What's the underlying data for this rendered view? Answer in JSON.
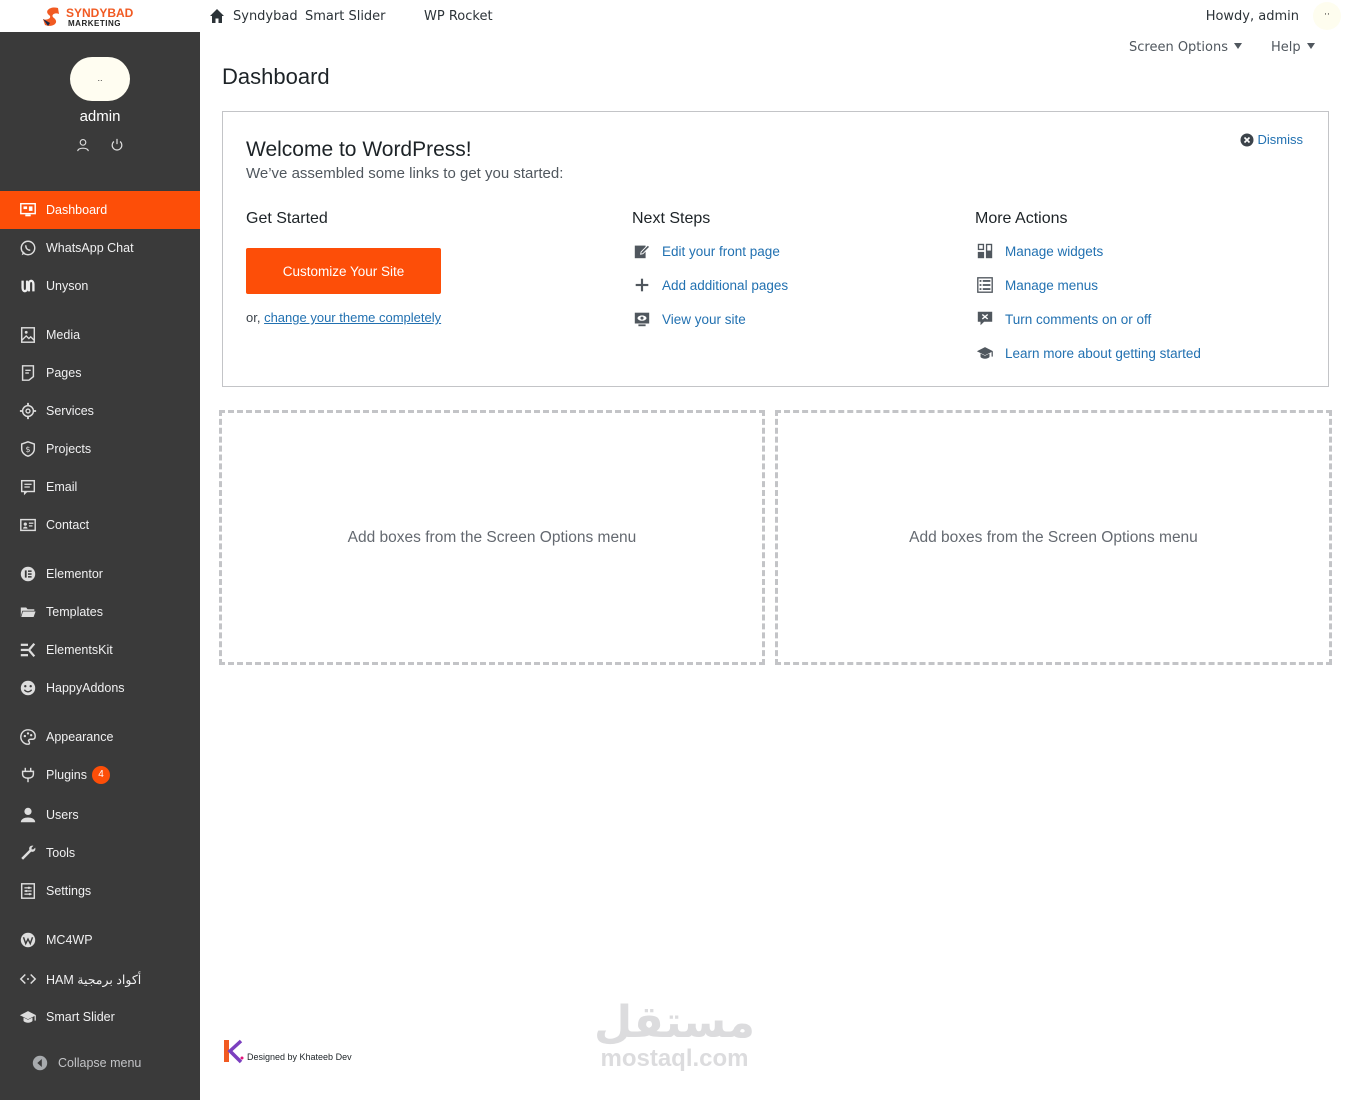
{
  "adminbar": {
    "logo_line1": "SYNDYBAD",
    "logo_line2": "MARKETING",
    "site_name": "Syndybad",
    "item_smart_slider": "Smart Slider",
    "item_wp_rocket": "WP Rocket",
    "howdy": "Howdy, admin",
    "avatar_text": "··"
  },
  "profile": {
    "pic_text": "..",
    "name": "admin"
  },
  "sidebar": {
    "items": [
      {
        "label": "Dashboard",
        "icon": "dashboard-icon"
      },
      {
        "label": "WhatsApp Chat",
        "icon": "whatsapp-icon"
      },
      {
        "label": "Unyson",
        "icon": "unyson-icon"
      },
      {
        "label": "Media",
        "icon": "media-icon"
      },
      {
        "label": "Pages",
        "icon": "pages-icon"
      },
      {
        "label": "Services",
        "icon": "services-icon"
      },
      {
        "label": "Projects",
        "icon": "projects-icon"
      },
      {
        "label": "Email",
        "icon": "email-icon"
      },
      {
        "label": "Contact",
        "icon": "contact-icon"
      },
      {
        "label": "Elementor",
        "icon": "elementor-icon"
      },
      {
        "label": "Templates",
        "icon": "templates-icon"
      },
      {
        "label": "ElementsKit",
        "icon": "elementskit-icon"
      },
      {
        "label": "HappyAddons",
        "icon": "happyaddons-icon"
      },
      {
        "label": "Appearance",
        "icon": "appearance-icon"
      },
      {
        "label": "Plugins",
        "icon": "plugins-icon",
        "badge": "4"
      },
      {
        "label": "Users",
        "icon": "users-icon"
      },
      {
        "label": "Tools",
        "icon": "tools-icon"
      },
      {
        "label": "Settings",
        "icon": "settings-icon"
      },
      {
        "label": "MC4WP",
        "icon": "mc4wp-icon"
      },
      {
        "label": "HAM أكواد برمجية",
        "icon": "code-icon"
      },
      {
        "label": "Smart Slider",
        "icon": "smart-slider-icon"
      }
    ],
    "collapse_label": "Collapse menu"
  },
  "screen_meta": {
    "screen_options": "Screen Options",
    "help": "Help"
  },
  "page": {
    "title": "Dashboard"
  },
  "welcome": {
    "heading": "Welcome to WordPress!",
    "about": "We’ve assembled some links to get you started:",
    "dismiss": "Dismiss",
    "get_started": {
      "heading": "Get Started",
      "button": "Customize Your Site",
      "or_text": "or, ",
      "link": "change your theme completely"
    },
    "next_steps": {
      "heading": "Next Steps",
      "links": [
        "Edit your front page",
        "Add additional pages",
        "View your site"
      ]
    },
    "more_actions": {
      "heading": "More Actions",
      "links": [
        "Manage widgets",
        "Manage menus",
        "Turn comments on or off",
        "Learn more about getting started"
      ]
    }
  },
  "dropzones": [
    "Add boxes from the Screen Options menu",
    "Add boxes from the Screen Options menu"
  ],
  "footer": {
    "credit": "Designed by Khateeb Dev"
  },
  "watermark": {
    "arabic": "مستقل",
    "latin": "mostaql.com"
  },
  "colors": {
    "accent": "#fd4e08",
    "sidebar_bg": "#3a3a3a",
    "link": "#2271b1"
  }
}
